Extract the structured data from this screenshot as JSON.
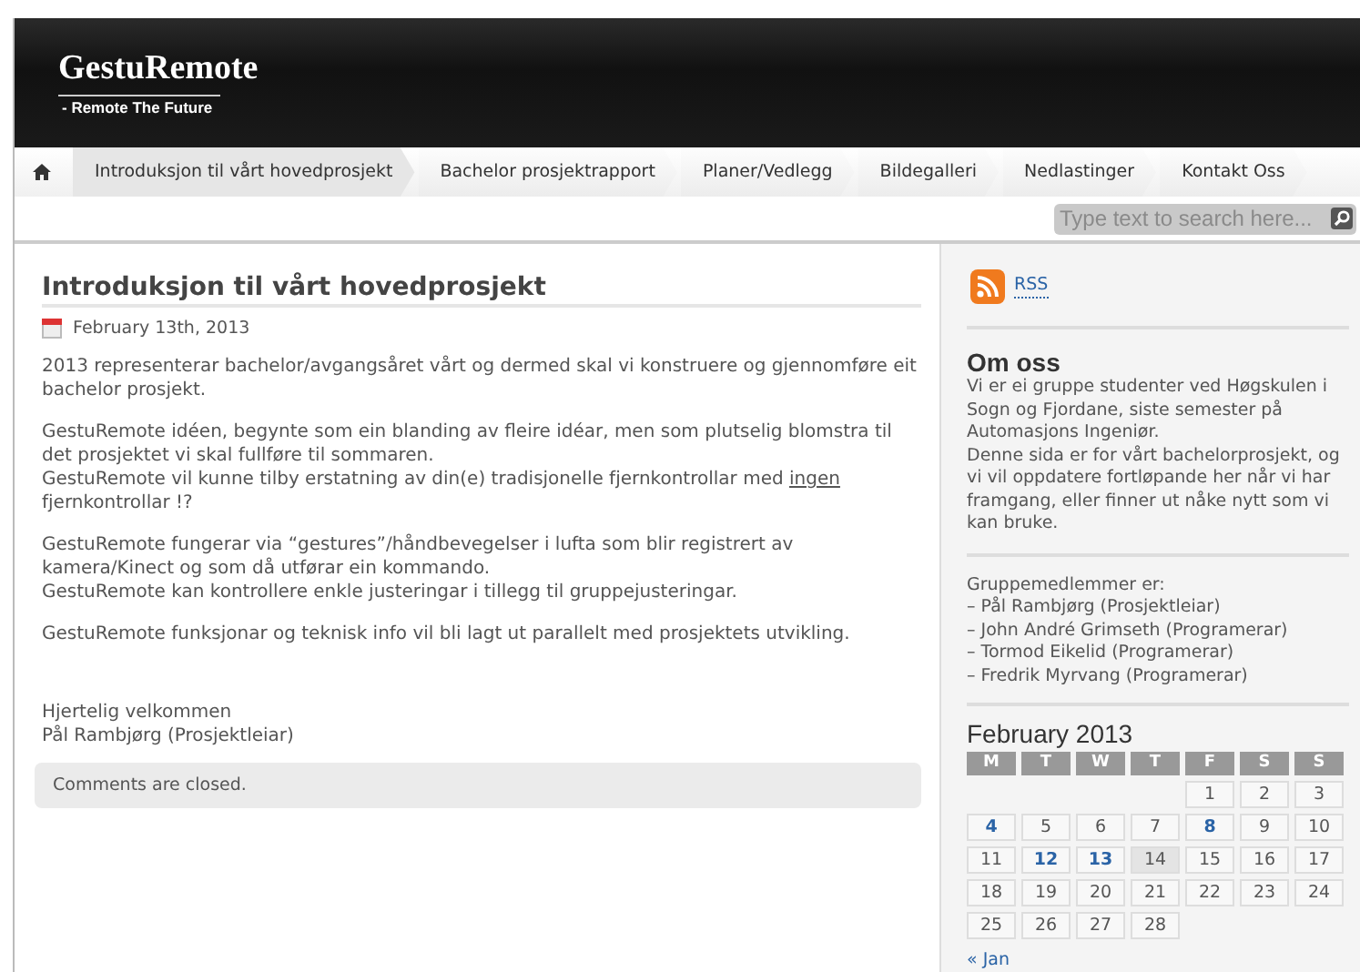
{
  "header": {
    "title": "GestuRemote",
    "tagline": "- Remote The Future"
  },
  "nav": [
    {
      "label": "Introduksjon til vårt hovedprosjekt",
      "selected": true
    },
    {
      "label": "Bachelor prosjektrapport",
      "selected": false
    },
    {
      "label": "Planer/Vedlegg",
      "selected": false
    },
    {
      "label": "Bildegalleri",
      "selected": false
    },
    {
      "label": "Nedlastinger",
      "selected": false
    },
    {
      "label": "Kontakt Oss",
      "selected": false
    }
  ],
  "search": {
    "placeholder": "Type text to search here..."
  },
  "post": {
    "title": "Introduksjon til vårt hovedprosjekt",
    "date": "February 13th, 2013",
    "paragraphs": [
      [
        [
          {
            "text": "2013 representerar bachelor/avgangsåret vårt og dermed skal vi konstruere og gjennomføre eit bachelor prosjekt.",
            "link": false
          }
        ]
      ],
      [
        [
          {
            "text": "GestuRemote idéen, begynte som ein blanding av fleire idéar, men som plutselig blomstra til det prosjektet vi skal fullføre til sommaren.",
            "link": false
          }
        ],
        [
          {
            "text": "GestuRemote vil kunne tilby erstatning av din(e) tradisjonelle fjernkontrollar med ",
            "link": false
          },
          {
            "text": "ingen",
            "link": true
          },
          {
            "text": " fjernkontrollar !?",
            "link": false
          }
        ]
      ],
      [
        [
          {
            "text": "GestuRemote fungerar via “gestures”/håndbevegelser i lufta som blir registrert av kamera/Kinect og som då utførar ein kommando.",
            "link": false
          }
        ],
        [
          {
            "text": "GestuRemote kan kontrollere enkle justeringar i tillegg til gruppejusteringar.",
            "link": false
          }
        ]
      ],
      [
        [
          {
            "text": "GestuRemote funksjonar og teknisk info vil bli lagt ut parallelt med prosjektets utvikling.",
            "link": false
          }
        ]
      ]
    ],
    "signature": [
      "Hjertelig velkommen",
      "Pål Rambjørg (Prosjektleiar)"
    ],
    "comments": "Comments are closed."
  },
  "sidebar": {
    "rss": "RSS",
    "about": {
      "title": "Om oss",
      "lines": [
        "Vi er ei gruppe studenter ved Høgskulen i Sogn og Fjordane, siste semester på Automasjons Ingeniør.",
        "Denne sida er for vårt bachelorprosjekt, og vi vil oppdatere fortløpande her når vi har framgang, eller finner ut nåke nytt som vi kan bruke."
      ]
    },
    "members": [
      "Gruppemedlemmer er:",
      "– Pål Rambjørg (Prosjektleiar)",
      "– John André Grimseth (Programerar)",
      "– Tormod Eikelid (Programerar)",
      "– Fredrik Myrvang (Programerar)"
    ],
    "calendar": {
      "title": "February 2013",
      "weekdays": [
        "M",
        "T",
        "W",
        "T",
        "F",
        "S",
        "S"
      ],
      "weeks": [
        {
          "kind": "end",
          "days": [
            {
              "day": "1",
              "linked": false,
              "today": false
            },
            {
              "day": "2",
              "linked": false,
              "today": false
            },
            {
              "day": "3",
              "linked": false,
              "today": false
            }
          ]
        },
        {
          "kind": "start",
          "days": [
            {
              "day": "4",
              "linked": true,
              "today": false
            },
            {
              "day": "5",
              "linked": false,
              "today": false
            },
            {
              "day": "6",
              "linked": false,
              "today": false
            },
            {
              "day": "7",
              "linked": false,
              "today": false
            },
            {
              "day": "8",
              "linked": true,
              "today": false
            },
            {
              "day": "9",
              "linked": false,
              "today": false
            },
            {
              "day": "10",
              "linked": false,
              "today": false
            }
          ]
        },
        {
          "kind": "start",
          "days": [
            {
              "day": "11",
              "linked": false,
              "today": false
            },
            {
              "day": "12",
              "linked": true,
              "today": false
            },
            {
              "day": "13",
              "linked": true,
              "today": false
            },
            {
              "day": "14",
              "linked": false,
              "today": true
            },
            {
              "day": "15",
              "linked": false,
              "today": false
            },
            {
              "day": "16",
              "linked": false,
              "today": false
            },
            {
              "day": "17",
              "linked": false,
              "today": false
            }
          ]
        },
        {
          "kind": "start",
          "days": [
            {
              "day": "18",
              "linked": false,
              "today": false
            },
            {
              "day": "19",
              "linked": false,
              "today": false
            },
            {
              "day": "20",
              "linked": false,
              "today": false
            },
            {
              "day": "21",
              "linked": false,
              "today": false
            },
            {
              "day": "22",
              "linked": false,
              "today": false
            },
            {
              "day": "23",
              "linked": false,
              "today": false
            },
            {
              "day": "24",
              "linked": false,
              "today": false
            }
          ]
        },
        {
          "kind": "start",
          "days": [
            {
              "day": "25",
              "linked": false,
              "today": false
            },
            {
              "day": "26",
              "linked": false,
              "today": false
            },
            {
              "day": "27",
              "linked": false,
              "today": false
            },
            {
              "day": "28",
              "linked": false,
              "today": false
            }
          ]
        }
      ],
      "prev": "« Jan"
    }
  }
}
